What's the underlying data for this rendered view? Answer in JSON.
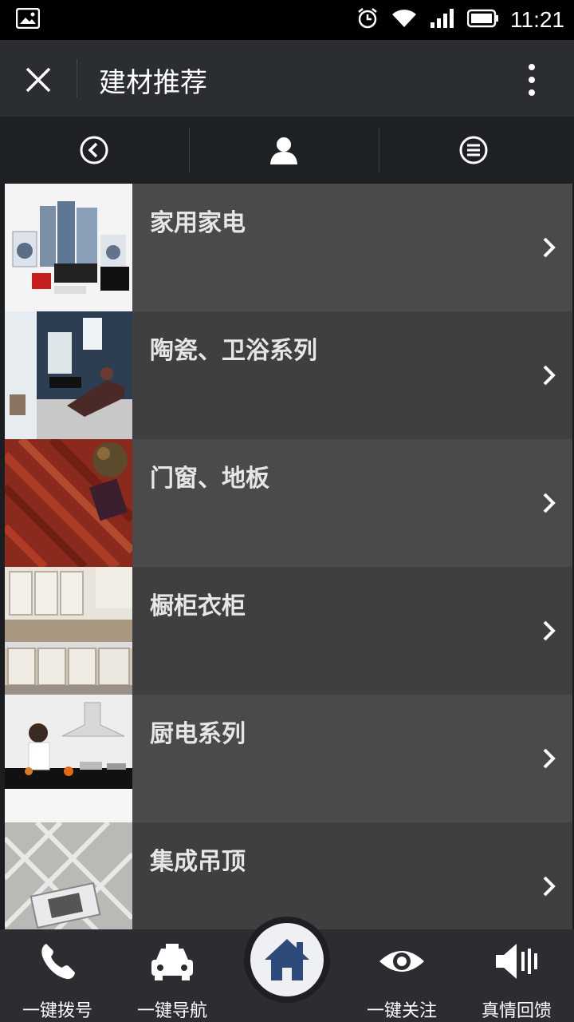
{
  "status_bar": {
    "time": "11:21"
  },
  "header": {
    "title": "建材推荐"
  },
  "list": {
    "items": [
      {
        "label": "家用家电"
      },
      {
        "label": "陶瓷、卫浴系列"
      },
      {
        "label": "门窗、地板"
      },
      {
        "label": "橱柜衣柜"
      },
      {
        "label": "厨电系列"
      },
      {
        "label": "集成吊顶"
      }
    ]
  },
  "bottom_nav": {
    "call": "一键拨号",
    "navigate": "一键导航",
    "follow": "一键关注",
    "feedback": "真情回馈"
  }
}
